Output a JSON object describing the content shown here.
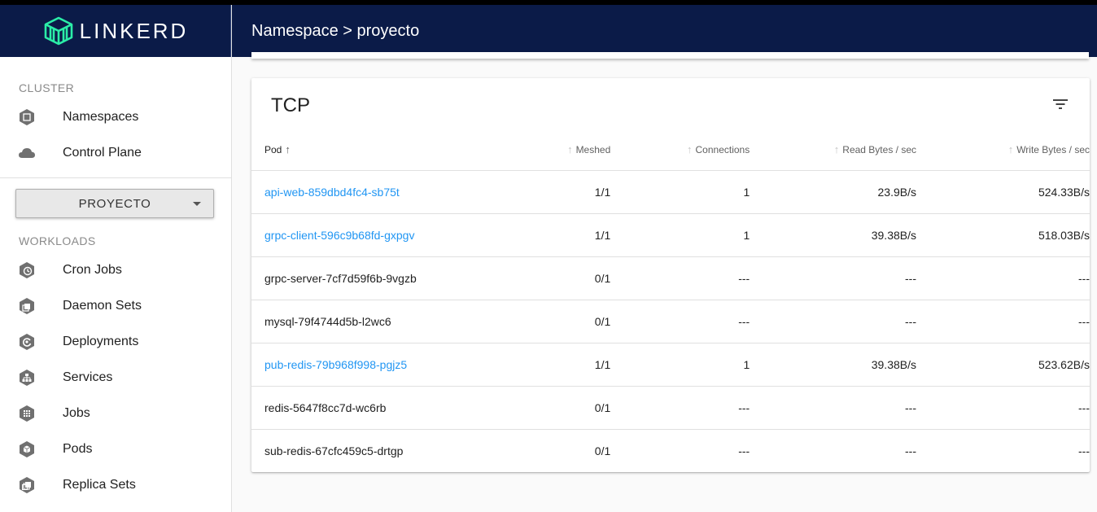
{
  "app": {
    "brand": "LINKERD"
  },
  "header": {
    "title": "Namespace > proyecto"
  },
  "sidebar": {
    "cluster_label": "CLUSTER",
    "cluster_items": [
      {
        "label": "Namespaces",
        "icon": "namespace-icon"
      },
      {
        "label": "Control Plane",
        "icon": "cloud-icon"
      }
    ],
    "namespace_select": {
      "value": "PROYECTO"
    },
    "workloads_label": "WORKLOADS",
    "workload_items": [
      {
        "label": "Cron Jobs",
        "icon": "cronjob-icon"
      },
      {
        "label": "Daemon Sets",
        "icon": "daemonset-icon"
      },
      {
        "label": "Deployments",
        "icon": "deployment-icon"
      },
      {
        "label": "Services",
        "icon": "service-icon"
      },
      {
        "label": "Jobs",
        "icon": "job-icon"
      },
      {
        "label": "Pods",
        "icon": "pod-icon"
      },
      {
        "label": "Replica Sets",
        "icon": "replicaset-icon"
      }
    ]
  },
  "tcp_card": {
    "title": "TCP",
    "columns": [
      "Pod",
      "Meshed",
      "Connections",
      "Read Bytes / sec",
      "Write Bytes / sec"
    ],
    "rows": [
      {
        "pod": "api-web-859dbd4fc4-sb75t",
        "link": true,
        "meshed": "1/1",
        "connections": "1",
        "read": "23.9B/s",
        "write": "524.33B/s"
      },
      {
        "pod": "grpc-client-596c9b68fd-gxpgv",
        "link": true,
        "meshed": "1/1",
        "connections": "1",
        "read": "39.38B/s",
        "write": "518.03B/s"
      },
      {
        "pod": "grpc-server-7cf7d59f6b-9vgzb",
        "link": false,
        "meshed": "0/1",
        "connections": "---",
        "read": "---",
        "write": "---"
      },
      {
        "pod": "mysql-79f4744d5b-l2wc6",
        "link": false,
        "meshed": "0/1",
        "connections": "---",
        "read": "---",
        "write": "---"
      },
      {
        "pod": "pub-redis-79b968f998-pgjz5",
        "link": true,
        "meshed": "1/1",
        "connections": "1",
        "read": "39.38B/s",
        "write": "523.62B/s"
      },
      {
        "pod": "redis-5647f8cc7d-wc6rb",
        "link": false,
        "meshed": "0/1",
        "connections": "---",
        "read": "---",
        "write": "---"
      },
      {
        "pod": "sub-redis-67cfc459c5-drtgp",
        "link": false,
        "meshed": "0/1",
        "connections": "---",
        "read": "---",
        "write": "---"
      }
    ]
  },
  "colors": {
    "nav_bg": "#0b1b48",
    "link": "#2196f3",
    "logo": "#2beda7"
  }
}
